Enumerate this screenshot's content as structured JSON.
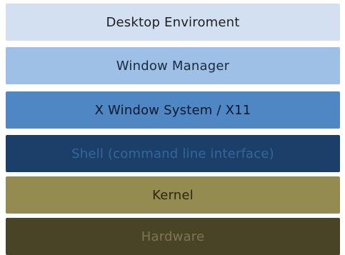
{
  "layers": [
    {
      "label": "Desktop Enviroment",
      "fill": "#d3e0f2",
      "text_color": "#1f1f1f"
    },
    {
      "label": "Window Manager",
      "fill": "#9ebfe6",
      "text_color": "#1c2b3c"
    },
    {
      "label": "X Window System / X11",
      "fill": "#4f86c4",
      "text_color": "#0d1a2a"
    },
    {
      "label": "Shell (command line interface)",
      "fill": "#1b3f68",
      "text_color": "#35679c"
    },
    {
      "label": "Kernel",
      "fill": "#948b51",
      "text_color": "#2b2710"
    },
    {
      "label": "Hardware",
      "fill": "#4a4427",
      "text_color": "#7f7650"
    }
  ]
}
